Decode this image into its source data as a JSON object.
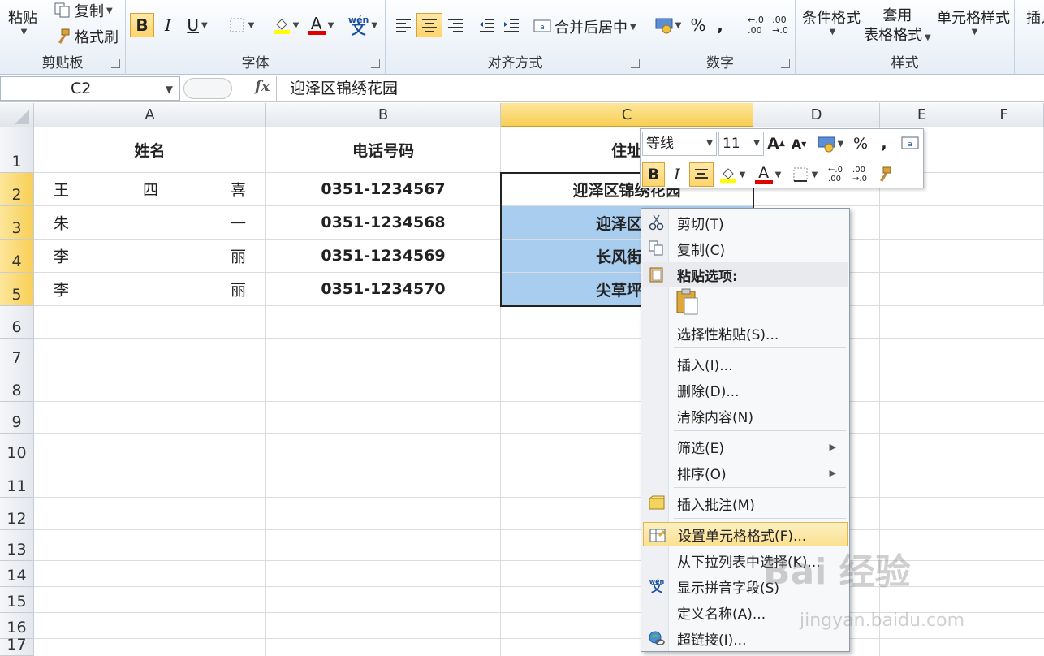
{
  "ribbon": {
    "clipboard": {
      "paste": "粘贴",
      "copy": "复制",
      "format_painter": "格式刷",
      "label": "剪贴板"
    },
    "font": {
      "bold": "B",
      "italic": "I",
      "underline": "U",
      "font_color": "A",
      "phonetic": "wén",
      "label": "字体"
    },
    "alignment": {
      "merge_center": "合并后居中",
      "label": "对齐方式"
    },
    "number": {
      "percent": "%",
      "comma": ",",
      "label": "数字"
    },
    "styles": {
      "conditional": "条件格式",
      "format_table_line1": "套用",
      "format_table_line2": "表格格式",
      "cell_styles": "单元格样式",
      "label": "样式"
    },
    "cells": {
      "insert": "插入"
    }
  },
  "formula_bar": {
    "name_box": "C2",
    "fx": "fx",
    "content": "迎泽区锦绣花园"
  },
  "columns": [
    "A",
    "B",
    "C",
    "D",
    "E",
    "F"
  ],
  "rows": [
    "1",
    "2",
    "3",
    "4",
    "5",
    "6",
    "7",
    "8",
    "9",
    "10",
    "11",
    "12",
    "13",
    "14",
    "15",
    "16",
    "17"
  ],
  "sheet": {
    "headers": {
      "name": "姓名",
      "phone": "电话号码",
      "address": "住址"
    },
    "data": [
      {
        "name": [
          "王",
          "四",
          "喜"
        ],
        "phone": "0351-1234567",
        "address": "迎泽区锦绣花园"
      },
      {
        "name": [
          "朱",
          "",
          "一"
        ],
        "phone": "0351-1234568",
        "address": "迎泽区幸"
      },
      {
        "name": [
          "李",
          "",
          "丽"
        ],
        "phone": "0351-1234569",
        "address": "长风街高"
      },
      {
        "name": [
          "李",
          "",
          "丽"
        ],
        "phone": "0351-1234570",
        "address": "尖草坪区"
      }
    ]
  },
  "mini_toolbar": {
    "font_name": "等线",
    "font_size": "11",
    "bold": "B",
    "italic": "I",
    "percent": "%",
    "comma": ","
  },
  "context_menu": {
    "cut": "剪切(T)",
    "copy": "复制(C)",
    "paste_options": "粘贴选项:",
    "paste_special": "选择性粘贴(S)...",
    "insert": "插入(I)...",
    "delete": "删除(D)...",
    "clear": "清除内容(N)",
    "filter": "筛选(E)",
    "sort": "排序(O)",
    "insert_comment": "插入批注(M)",
    "format_cells": "设置单元格格式(F)...",
    "pick_list": "从下拉列表中选择(K)...",
    "phonetic": "显示拼音字段(S)",
    "define_name": "定义名称(A)...",
    "hyperlink": "超链接(I)..."
  },
  "watermark": {
    "main": "Bai 经验",
    "sub": "jingyan.baidu.com"
  }
}
